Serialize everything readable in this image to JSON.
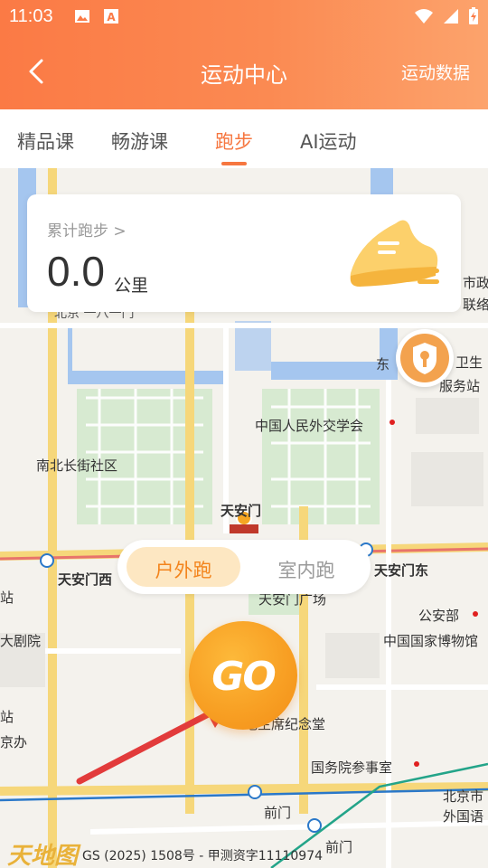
{
  "status_bar": {
    "time": "11:03"
  },
  "header": {
    "title": "运动中心",
    "right_link": "运动数据"
  },
  "tabs": [
    {
      "label": "精品课"
    },
    {
      "label": "畅游课"
    },
    {
      "label": "跑步"
    },
    {
      "label": "AI运动"
    }
  ],
  "active_tab": "跑步",
  "stats": {
    "link_label": "累计跑步 >",
    "distance_value": "0.0",
    "distance_unit": "公里"
  },
  "mode_switch": {
    "options": [
      "户外跑",
      "室内跑"
    ],
    "selected": "户外跑"
  },
  "go_button": {
    "label": "GO"
  },
  "map_labels": {
    "foreign_affairs": "中国人民外交学会",
    "nanbei": "南北长街社区",
    "tiananmen": "天安门",
    "tiananmen_west": "天安门西",
    "tiananmen_east": "天安门东",
    "square": "天安门广场",
    "police": "公安部",
    "museum": "中国国家博物馆",
    "memorial": "毛主席纪念堂",
    "state_council": "国务院参事室",
    "qianmen": "前门",
    "qianmen2": "前门",
    "beijing_foreign": "北京市",
    "foreign_lang": "外国语",
    "shizheng": "市政",
    "lianluo": "联络",
    "dong": "东",
    "weisheng": "卫生",
    "fuwuzhan": "服务站",
    "theatre": "大剧院",
    "station_left": "站",
    "station_left2": "站",
    "jingban": "京办",
    "beijing_partial": "北京 一八一门"
  },
  "map_footer": {
    "logo_text": "天地图",
    "copyright": "GS (2025) 1508号 - 甲测资字11110974"
  },
  "colors": {
    "header_start": "#fb7a45",
    "header_end": "#fca36c",
    "accent": "#f6763f",
    "go_button": "#f8a024"
  }
}
